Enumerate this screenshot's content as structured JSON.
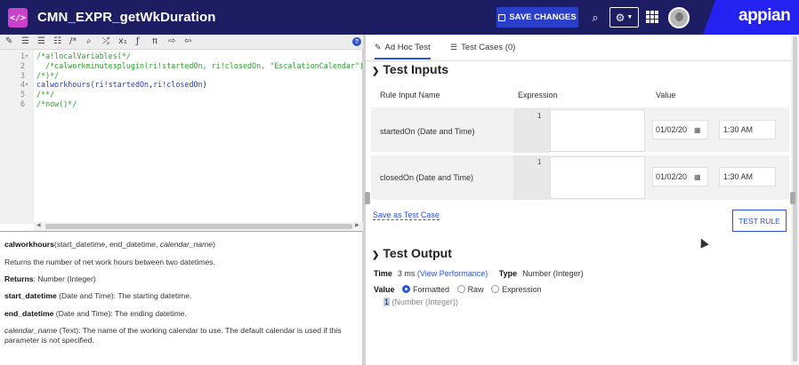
{
  "header": {
    "app_icon": "</>",
    "title": "CMN_EXPR_getWkDuration",
    "save_label": "SAVE CHANGES",
    "logo": "appian"
  },
  "editor": {
    "toolbar_icons": [
      "wand-icon",
      "indent-icon",
      "outdent-icon",
      "list-icon",
      "comment-icon",
      "search-icon",
      "shuffle-icon",
      "subscript-icon",
      "function-icon",
      "pi-icon",
      "export-icon",
      "import-icon",
      "help-icon"
    ],
    "lines": [
      {
        "n": "1",
        "fold": "▾",
        "parts": [
          {
            "t": "/*a!localVariables(*/",
            "c": "comment"
          }
        ]
      },
      {
        "n": "2",
        "fold": "",
        "parts": [
          {
            "t": "  /*calworkminutesplugin(ri!startedOn, ri!closedOn, \"EscalationCalendar\")",
            "c": "comment"
          }
        ]
      },
      {
        "n": "3",
        "fold": "",
        "parts": [
          {
            "t": "/*)*/",
            "c": "comment"
          }
        ]
      },
      {
        "n": "4",
        "fold": "▾",
        "parts": [
          {
            "t": "calworkhours(",
            "c": "func"
          },
          {
            "t": "ri!startedOn",
            "c": "func"
          },
          {
            "t": ",",
            "c": "paren"
          },
          {
            "t": "ri!closedOn",
            "c": "func"
          },
          {
            "t": ")",
            "c": "paren"
          }
        ]
      },
      {
        "n": "5",
        "fold": "",
        "parts": [
          {
            "t": "/**/",
            "c": "comment"
          }
        ]
      },
      {
        "n": "6",
        "fold": "",
        "parts": [
          {
            "t": "/*now()*/",
            "c": "comment"
          }
        ]
      }
    ]
  },
  "docs": {
    "signature_fn": "calworkhours",
    "signature_args": "(start_datetime, end_datetime, ",
    "signature_opt": "calendar_name",
    "signature_end": ")",
    "description": "Returns the number of net work hours between two datetimes.",
    "returns_label": "Returns",
    "returns_value": ": Number (Integer)",
    "param1_name": "start_datetime",
    "param1_desc": " (Date and Time): The starting datetime.",
    "param2_name": "end_datetime",
    "param2_desc": " (Date and Time): The ending datetime.",
    "param3_name": "calendar_name",
    "param3_desc": " (Text): The name of the working calendar to use. The default calendar is used if this parameter is not specified."
  },
  "tabs": {
    "adhoc": "Ad Hoc Test",
    "cases": "Test Cases (0)"
  },
  "inputs": {
    "title": "Test Inputs",
    "col_name": "Rule Input Name",
    "col_expr": "Expression",
    "col_value": "Value",
    "rows": [
      {
        "name": "startedOn (Date and Time)",
        "line": "1",
        "date": "01/02/20",
        "time": "1:30 AM"
      },
      {
        "name": "closedOn (Date and Time)",
        "line": "1",
        "date": "01/02/20",
        "time": "1:30 AM"
      }
    ],
    "save_case": "Save as Test Case",
    "test_rule": "TEST RULE"
  },
  "output": {
    "title": "Test Output",
    "time_label": "Time",
    "time_value": "3 ms",
    "time_link": "(View Performance)",
    "type_label": "Type",
    "type_value": "Number (Integer)",
    "value_label": "Value",
    "opt_formatted": "Formatted",
    "opt_raw": "Raw",
    "opt_expression": "Expression",
    "result_value": "1",
    "result_type": " (Number (Integer))"
  }
}
